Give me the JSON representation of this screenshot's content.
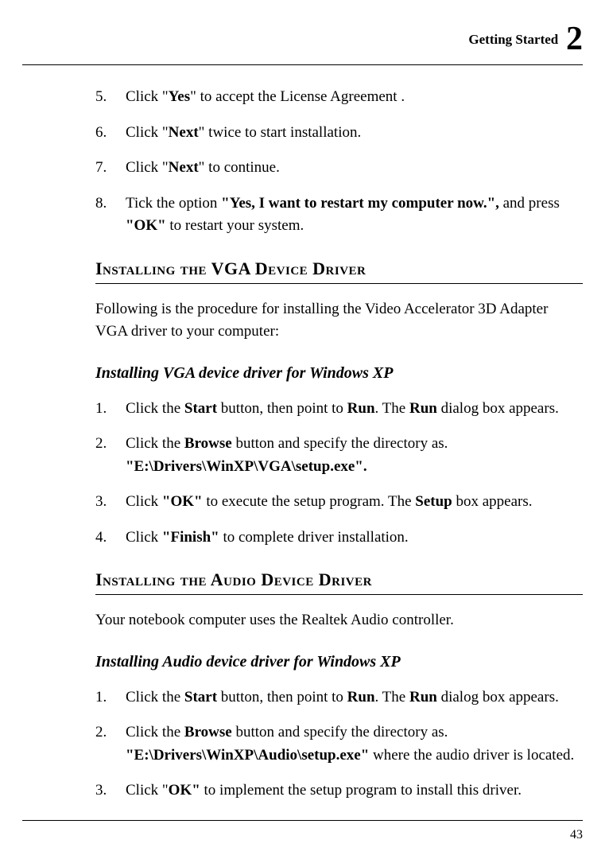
{
  "header": {
    "title": "Getting Started",
    "chapter_num": "2"
  },
  "first_list": [
    {
      "n": "5.",
      "segments": [
        {
          "t": "Click \"",
          "b": false
        },
        {
          "t": "Yes",
          "b": true
        },
        {
          "t": "\" to accept the License Agreement .",
          "b": false
        }
      ]
    },
    {
      "n": "6.",
      "segments": [
        {
          "t": "Click \"",
          "b": false
        },
        {
          "t": "Next",
          "b": true
        },
        {
          "t": "\" twice to start installation.",
          "b": false
        }
      ]
    },
    {
      "n": "7.",
      "segments": [
        {
          "t": "Click \"",
          "b": false
        },
        {
          "t": "Next",
          "b": true
        },
        {
          "t": "\" to continue.",
          "b": false
        }
      ]
    },
    {
      "n": "8.",
      "segments": [
        {
          "t": "Tick the option ",
          "b": false
        },
        {
          "t": "\"Yes, I want to restart my computer now.\",",
          "b": true
        },
        {
          "t": " and press ",
          "b": false
        },
        {
          "t": "\"OK\"",
          "b": true
        },
        {
          "t": " to restart your system.",
          "b": false
        }
      ]
    }
  ],
  "heading_vga": "Installing the VGA Device Driver",
  "para_vga": "Following is the procedure for installing the Video Accelerator 3D Adapter VGA driver to your computer:",
  "sub_vga": "Installing VGA device driver for Windows XP",
  "vga_list": [
    {
      "n": "1.",
      "segments": [
        {
          "t": "Click the ",
          "b": false
        },
        {
          "t": "Start",
          "b": true
        },
        {
          "t": " button, then point to ",
          "b": false
        },
        {
          "t": "Run",
          "b": true
        },
        {
          "t": ". The ",
          "b": false
        },
        {
          "t": "Run",
          "b": true
        },
        {
          "t": " dialog box appears.",
          "b": false
        }
      ]
    },
    {
      "n": "2.",
      "segments": [
        {
          "t": "Click the ",
          "b": false
        },
        {
          "t": "Browse",
          "b": true
        },
        {
          "t": " button and specify the directory as. ",
          "b": false
        },
        {
          "t": "\"E:\\Drivers\\WinXP\\VGA\\setup.exe\".",
          "b": true
        }
      ]
    },
    {
      "n": "3.",
      "segments": [
        {
          "t": "Click ",
          "b": false
        },
        {
          "t": "\"OK\"",
          "b": true
        },
        {
          "t": " to execute the setup program. The ",
          "b": false
        },
        {
          "t": "Setup",
          "b": true
        },
        {
          "t": " box appears.",
          "b": false
        }
      ]
    },
    {
      "n": "4.",
      "segments": [
        {
          "t": "Click ",
          "b": false
        },
        {
          "t": "\"Finish\"",
          "b": true
        },
        {
          "t": " to complete driver installation.",
          "b": false
        }
      ]
    }
  ],
  "heading_audio": "Installing the Audio Device Driver",
  "para_audio": "Your notebook computer uses the Realtek Audio controller.",
  "sub_audio": "Installing Audio device driver for Windows XP",
  "audio_list": [
    {
      "n": "1.",
      "segments": [
        {
          "t": "Click the ",
          "b": false
        },
        {
          "t": "Start",
          "b": true
        },
        {
          "t": " button, then point to ",
          "b": false
        },
        {
          "t": "Run",
          "b": true
        },
        {
          "t": ". The ",
          "b": false
        },
        {
          "t": "Run",
          "b": true
        },
        {
          "t": " dialog box appears.",
          "b": false
        }
      ]
    },
    {
      "n": "2.",
      "segments": [
        {
          "t": "Click the ",
          "b": false
        },
        {
          "t": "Browse",
          "b": true
        },
        {
          "t": " button and specify the directory as. ",
          "b": false
        },
        {
          "t": "\"E:\\Drivers\\WinXP\\Audio\\setup.exe\"",
          "b": true
        },
        {
          "t": " where the audio driver is located.",
          "b": false
        }
      ]
    },
    {
      "n": "3.",
      "segments": [
        {
          "t": "Click \"",
          "b": false
        },
        {
          "t": "OK\"",
          "b": true
        },
        {
          "t": " to implement the setup program to install this driver.",
          "b": false
        }
      ]
    }
  ],
  "page_number": "43"
}
